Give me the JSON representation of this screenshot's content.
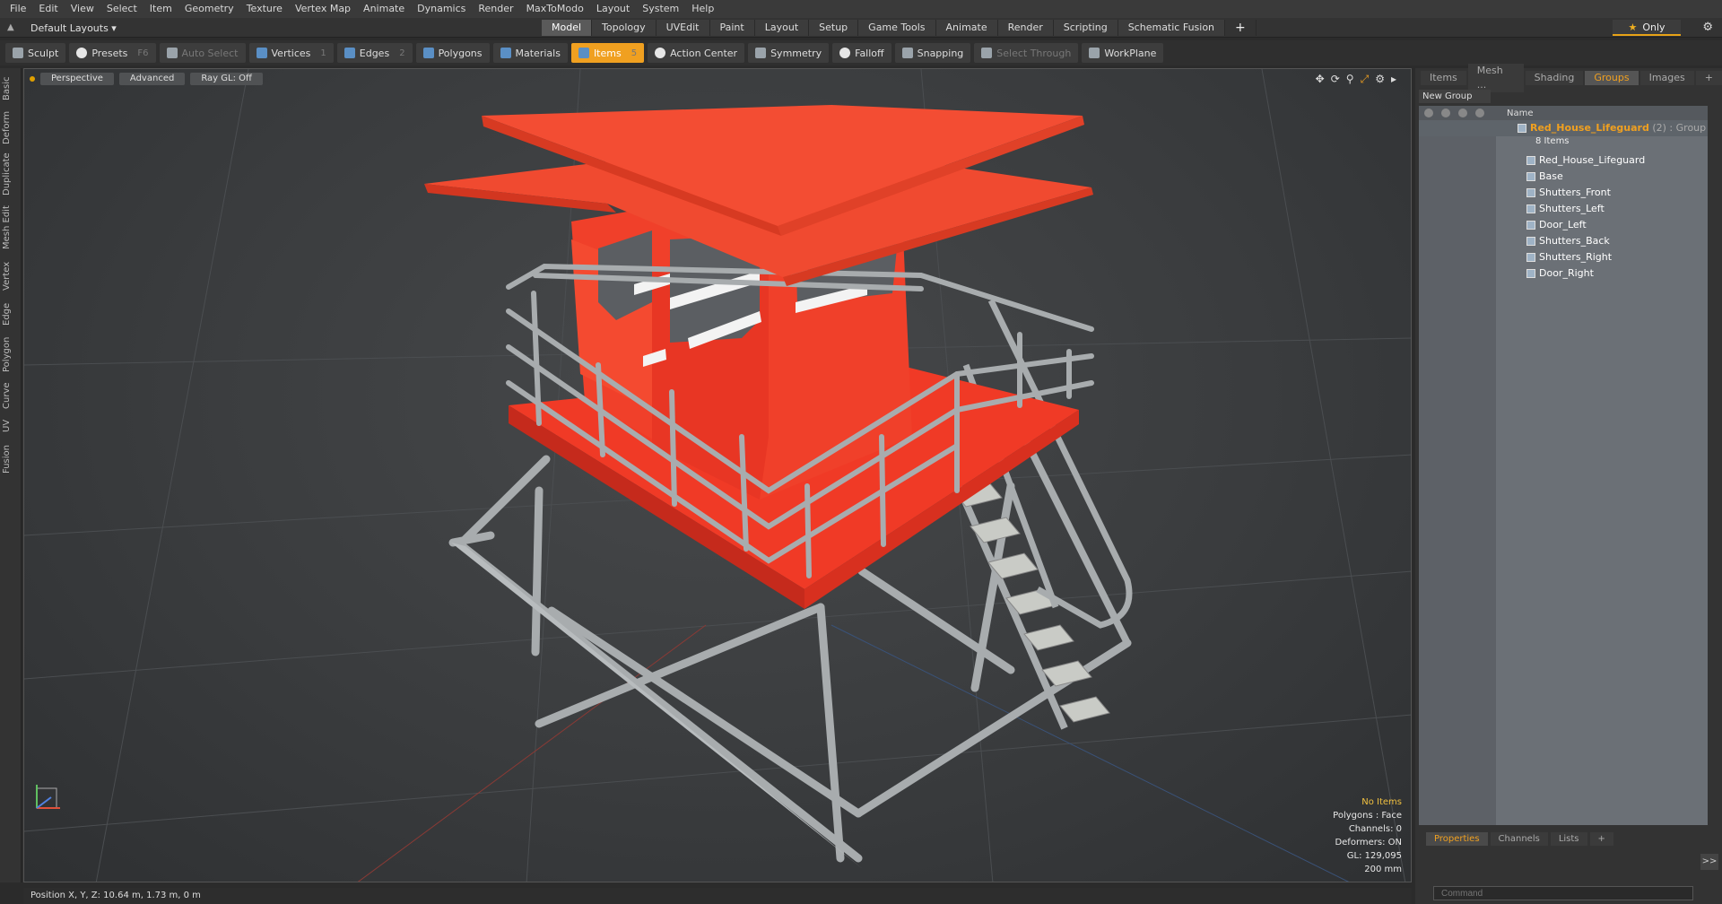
{
  "menu": [
    "File",
    "Edit",
    "View",
    "Select",
    "Item",
    "Geometry",
    "Texture",
    "Vertex Map",
    "Animate",
    "Dynamics",
    "Render",
    "MaxToModo",
    "Layout",
    "System",
    "Help"
  ],
  "layout_selector": "Default Layouts ▾",
  "mode_tabs": [
    "Model",
    "Topology",
    "UVEdit",
    "Paint",
    "Layout",
    "Setup",
    "Game Tools",
    "Animate",
    "Render",
    "Scripting",
    "Schematic Fusion",
    "+"
  ],
  "only_label": "Only",
  "toolbar": {
    "sculpt": "Sculpt",
    "presets": "Presets",
    "presets_key": "F6",
    "auto_select": "Auto Select",
    "vertices": "Vertices",
    "vertices_key": "1",
    "edges": "Edges",
    "edges_key": "2",
    "polygons": "Polygons",
    "materials": "Materials",
    "items": "Items",
    "items_key": "5",
    "action_center": "Action Center",
    "symmetry": "Symmetry",
    "falloff": "Falloff",
    "snapping": "Snapping",
    "select_through": "Select Through",
    "workplane": "WorkPlane"
  },
  "left_tabs": [
    "Basic",
    "Deform",
    "Duplicate",
    "Mesh Edit",
    "Vertex",
    "Edge",
    "Polygon",
    "Curve",
    "UV",
    "Fusion"
  ],
  "viewport": {
    "view": "Perspective",
    "shading": "Advanced",
    "raygl": "Ray GL: Off"
  },
  "stats": {
    "items": "No Items",
    "polygons": "Polygons : Face",
    "channels": "Channels: 0",
    "deformers": "Deformers: ON",
    "gl": "GL: 129,095",
    "size": "200 mm"
  },
  "right_panel": {
    "tabs": [
      "Items",
      "Mesh ...",
      "Shading",
      "Groups",
      "Images",
      "+"
    ],
    "new_group": "New Group",
    "name_header": "Name",
    "group": {
      "name": "Red_House_Lifeguard",
      "suffix": " (2) : Group",
      "count": "8 Items"
    },
    "children": [
      "Red_House_Lifeguard",
      "Base",
      "Shutters_Front",
      "Shutters_Left",
      "Door_Left",
      "Shutters_Back",
      "Shutters_Right",
      "Door_Right"
    ],
    "bottom_tabs": [
      "Properties",
      "Channels",
      "Lists",
      "+"
    ],
    "command_placeholder": "Command"
  },
  "status": "Position X, Y, Z:   10.64 m, 1.73 m, 0 m",
  "colors": {
    "accent": "#f0a020",
    "model_red": "#f03a26",
    "rail_gray": "#a8acae"
  }
}
